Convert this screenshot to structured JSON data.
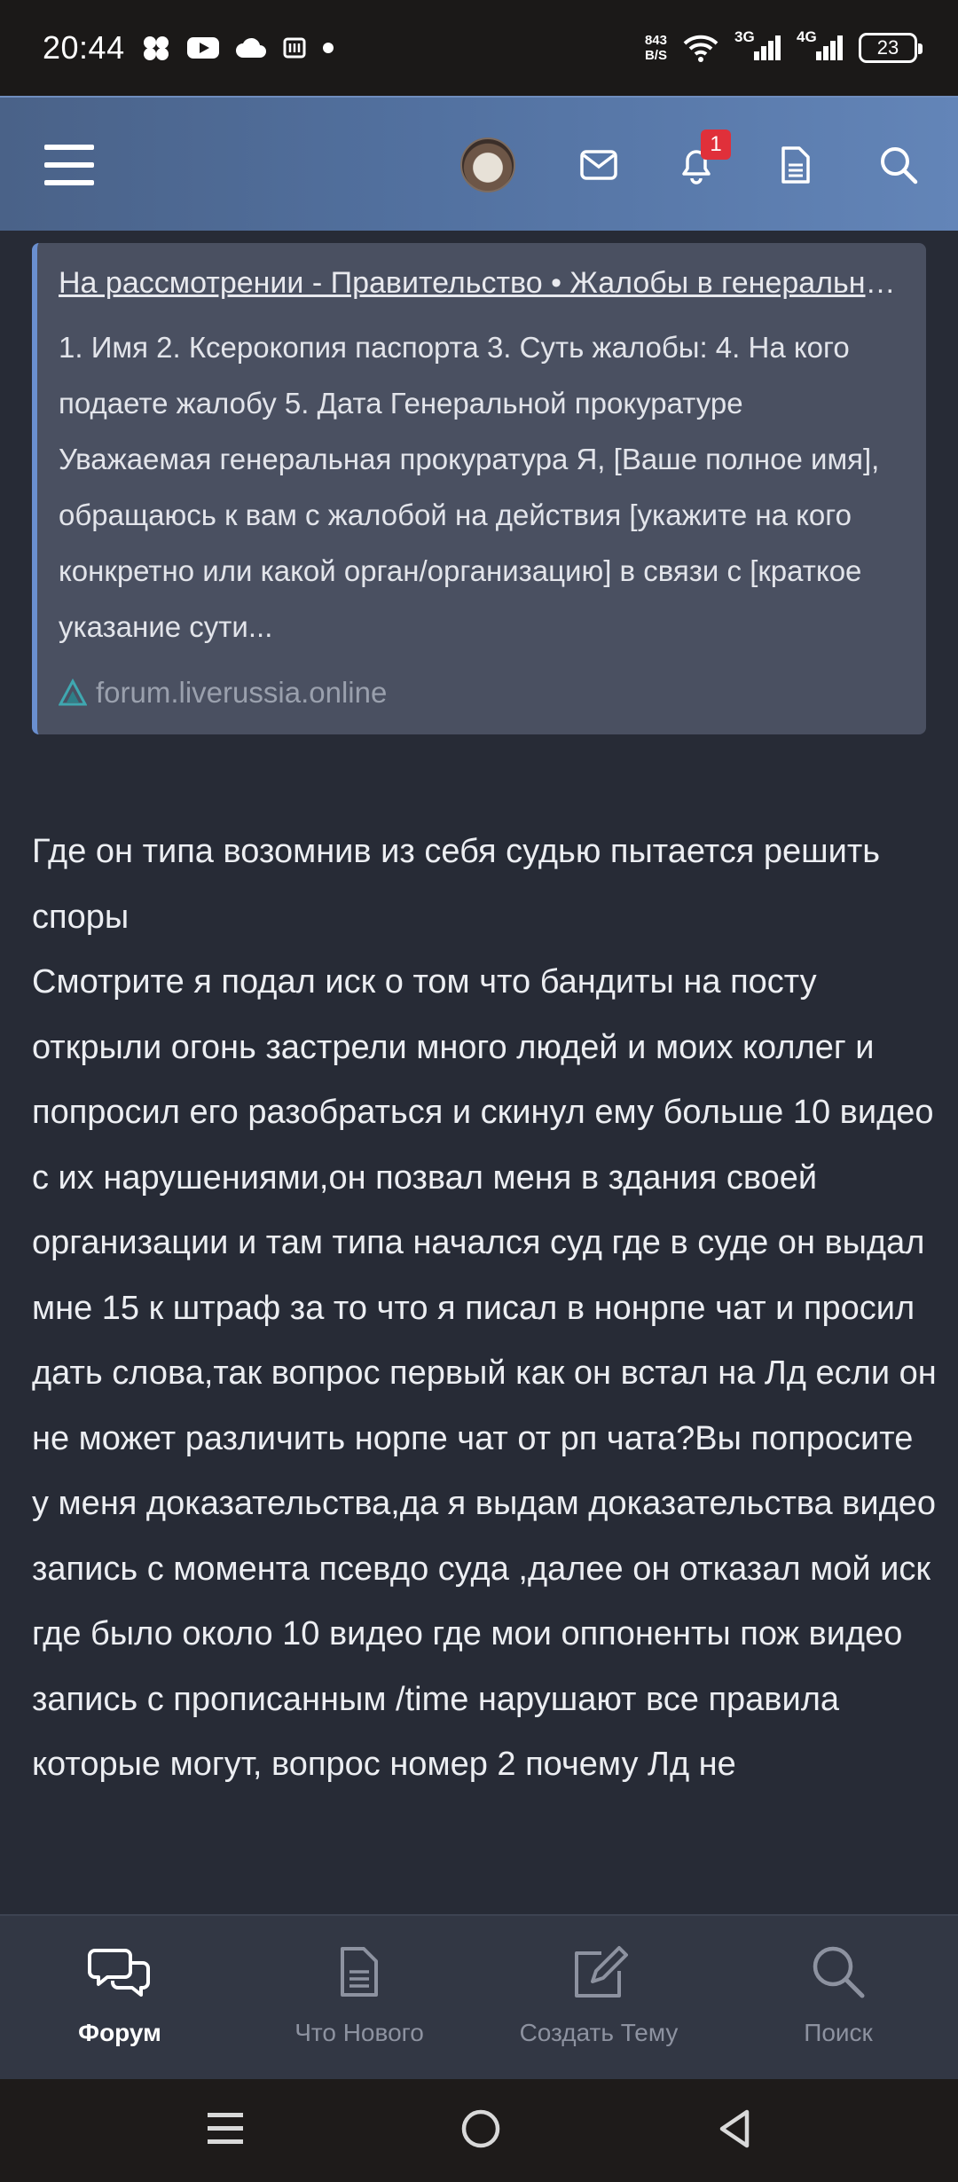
{
  "status_bar": {
    "time": "20:44",
    "net_speed_value": "843",
    "net_speed_unit": "B/S",
    "sig1_label": "3G",
    "sig2_label": "4G",
    "battery": "23"
  },
  "app_bar": {
    "notification_count": "1"
  },
  "quote": {
    "title": "На рассмотрении - Правительство • Жалобы в генеральную прокуратуру",
    "body": "1. Имя 2. Ксерокопия паспорта 3. Суть жалобы: 4. На кого подаете жалобу 5. Дата Генеральной прокуратуре Уважаемая генеральная прокуратура Я, [Ваше полное имя], обращаюсь к вам с жалобой на действия [укажите на кого конкретно или какой орган/организацию] в связи с [краткое указание сути...",
    "source": "forum.liverussia.online"
  },
  "post": {
    "line1": "Где он типа возомнив из себя судью пытается решить споры",
    "line2": "Смотрите я подал иск о том что бандиты на посту открыли огонь застрели много людей и моих коллег и попросил его разобраться и скинул ему больше 10 видео с их нарушениями,он позвал меня в здания своей организации и там типа начался суд где в суде он выдал мне 15 к штраф за то что я писал в нонрпе чат и просил дать слова,так вопрос первый как он встал на Лд если он не может различить норпе чат от рп чата?Вы попросите у меня доказательства,да я выдам доказательства видео запись с момента псевдо суда ,далее он отказал мой иск где было около 10 видео где мои оппоненты пож видео запись с прописанным /time нарушают все правила которые могут, вопрос номер 2 почему Лд не"
  },
  "bottom_nav": {
    "items": [
      {
        "label": "Форум",
        "icon": "chat-bubbles-icon"
      },
      {
        "label": "Что Нового",
        "icon": "document-icon"
      },
      {
        "label": "Создать Тему",
        "icon": "edit-icon"
      },
      {
        "label": "Поиск",
        "icon": "search-icon"
      }
    ]
  }
}
